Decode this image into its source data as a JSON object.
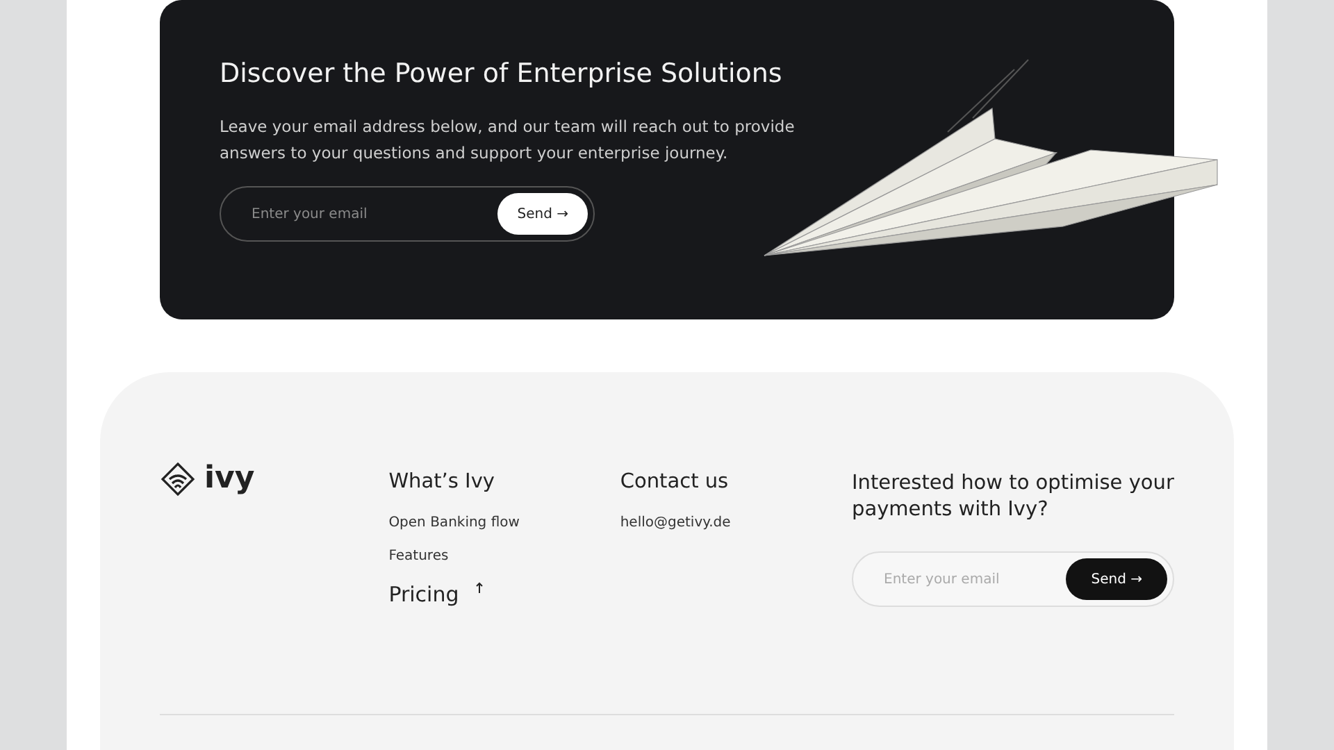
{
  "cta": {
    "title": "Discover the Power of Enterprise Solutions",
    "text": "Leave your email address below, and our team will reach out to provide answers to your questions and support your enterprise journey.",
    "email": {
      "placeholder": "Enter your email"
    },
    "button": "Send →"
  },
  "footer": {
    "logo": "ivy",
    "columns": [
      {
        "heading": "What’s Ivy",
        "links": [
          {
            "label": "Open Banking flow",
            "kind": "small"
          },
          {
            "label": "Features",
            "kind": "small"
          },
          {
            "label": "Pricing",
            "kind": "large"
          }
        ]
      },
      {
        "heading": "Contact us",
        "links": [
          {
            "label": "hello@getivy.de",
            "kind": "small"
          }
        ]
      }
    ],
    "newsletter": {
      "heading": "Interested how to optimise your payments with Ivy?",
      "email": {
        "placeholder": "Enter your email"
      },
      "button": "Send →"
    }
  }
}
